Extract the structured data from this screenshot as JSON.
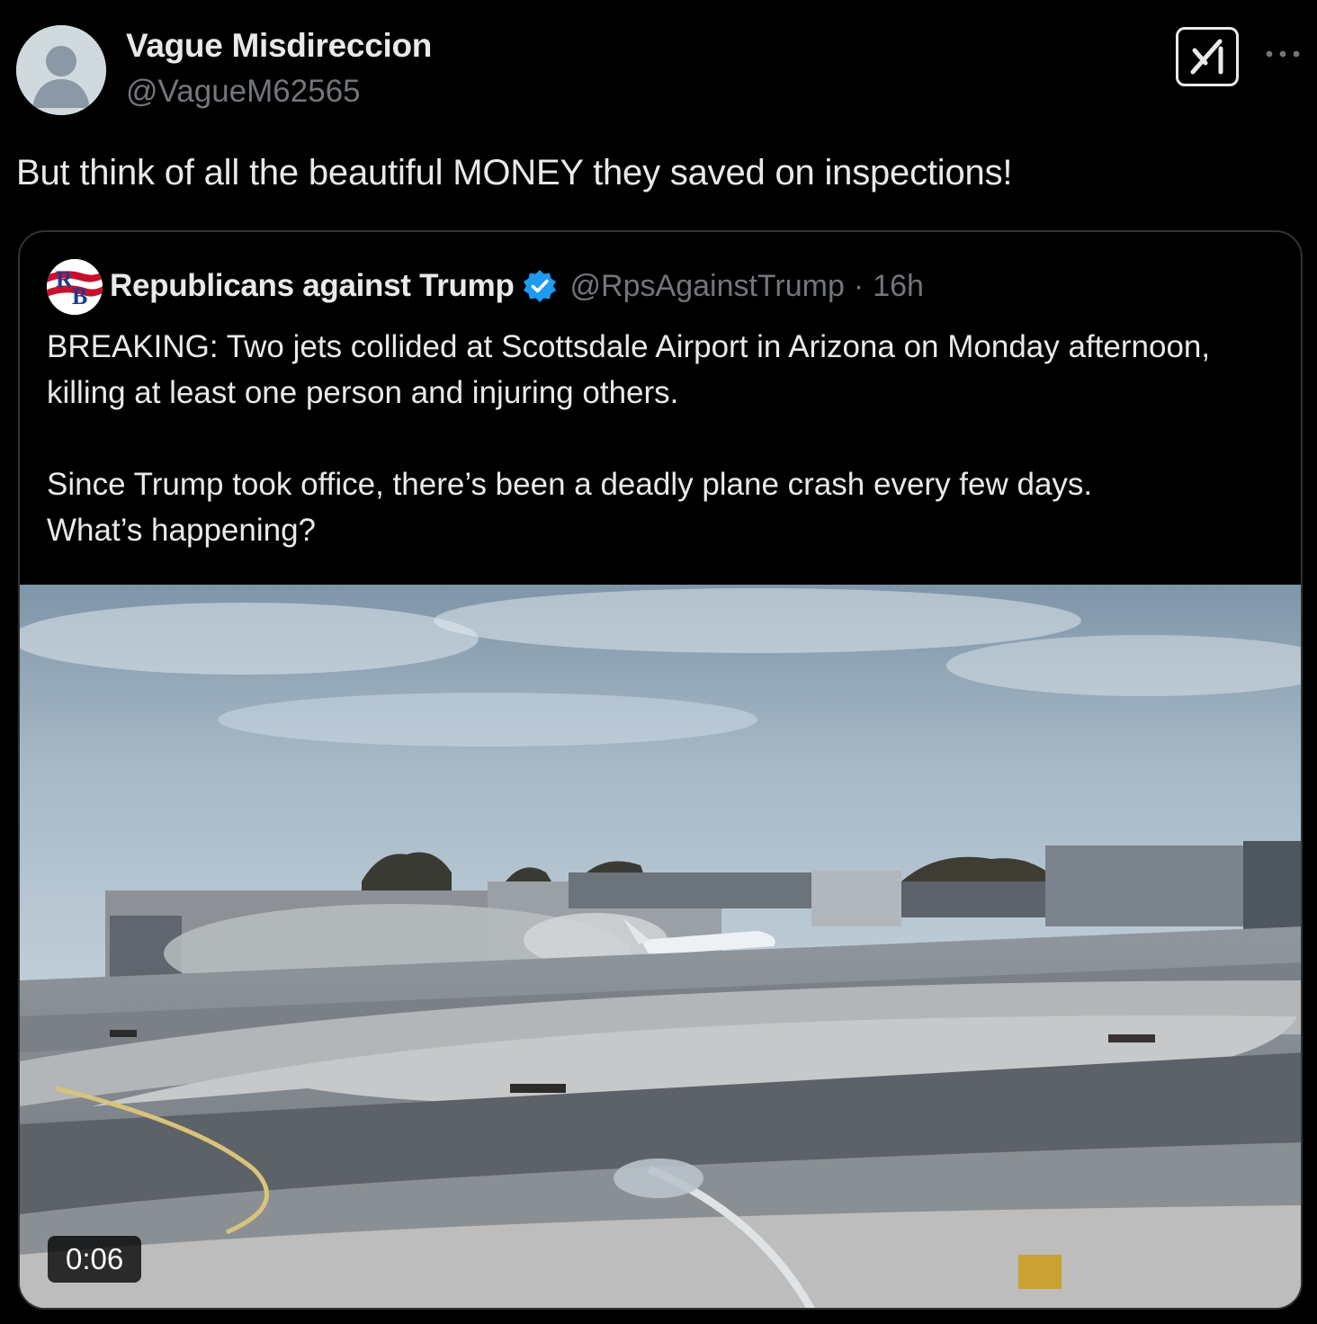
{
  "tweet": {
    "author_name": "Vague Misdireccion",
    "author_handle": "@VagueM62565",
    "text": "But think of all the beautiful MONEY they saved on inspections!",
    "grok_icon": "grok-icon",
    "more_icon": "more-icon"
  },
  "quoted": {
    "author_name": "Republicans against Trump",
    "author_handle": "@RpsAgainstTrump",
    "separator": "·",
    "time": "16h",
    "verified": true,
    "avatar_text": "RB",
    "paragraph1": "BREAKING: Two jets collided at Scottsdale Airport in Arizona on Monday afternoon, killing at least one person and injuring others.",
    "paragraph2_line1": "Since Trump took office, there’s been a deadly plane crash every few days.",
    "paragraph2_line2": "What’s happening?",
    "media": {
      "type": "video",
      "duration": "0:06"
    }
  },
  "colors": {
    "background": "#000000",
    "text": "#e7e9ea",
    "secondary": "#71767b",
    "border": "#2f3336",
    "verified": "#1d9bf0"
  }
}
